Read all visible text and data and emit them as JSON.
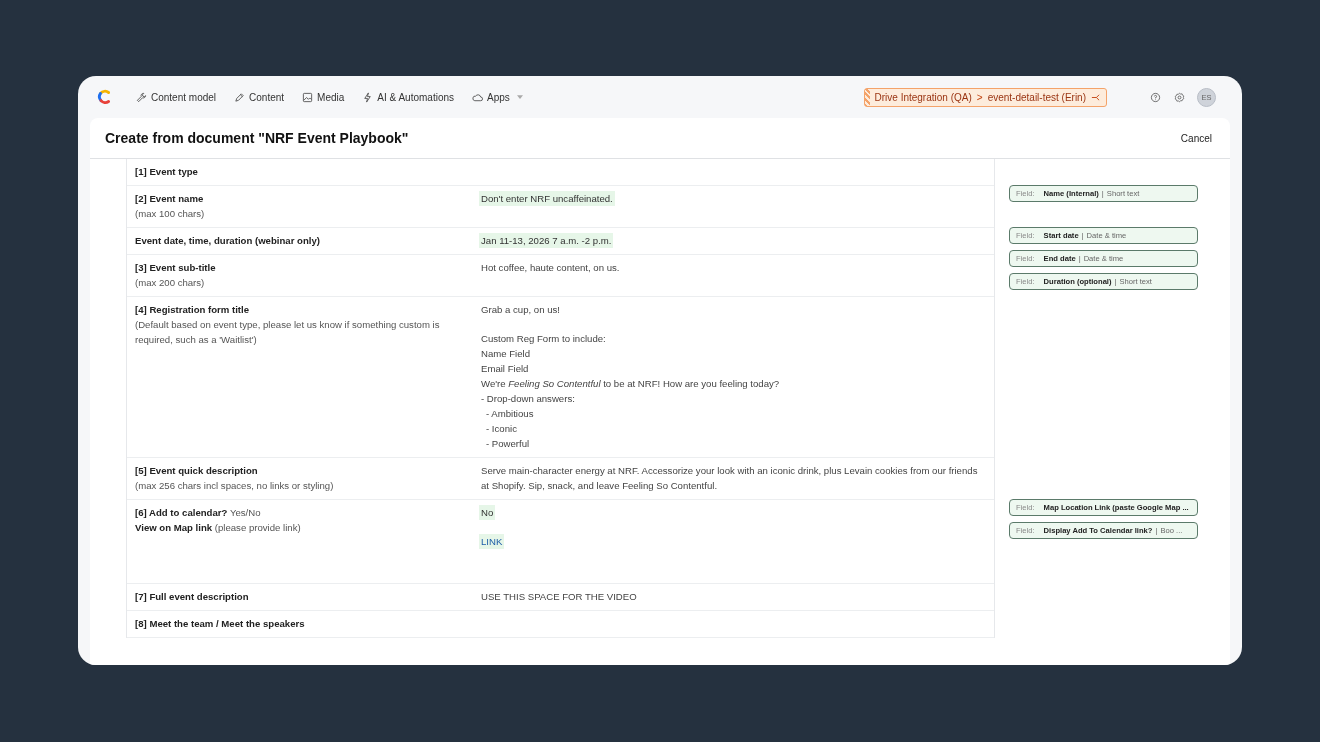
{
  "nav": {
    "items": [
      {
        "kind": "wrench",
        "label": "Content model"
      },
      {
        "kind": "pen",
        "label": "Content"
      },
      {
        "kind": "image",
        "label": "Media"
      },
      {
        "kind": "bolt",
        "label": "AI & Automations"
      },
      {
        "kind": "cloud",
        "label": "Apps",
        "caret": true
      }
    ]
  },
  "environment": {
    "space": "Drive Integration (QA)",
    "separator": ">",
    "environment": "event-detail-test (Erin)"
  },
  "user": {
    "initials": "ES"
  },
  "dialog": {
    "title": "Create from document \"NRF Event Playbook\"",
    "cancel": "Cancel"
  },
  "rows": [
    {
      "label": "[1] Event type"
    },
    {
      "label": "[2] Event name",
      "note": "(max 100 chars)",
      "values": [
        {
          "text": "Don't enter NRF uncaffeinated.",
          "kind": "highlight"
        }
      ],
      "tags": [
        {
          "prefix": "Field:",
          "name": "Name (Internal)",
          "separator": "|",
          "type": "Short text"
        }
      ]
    },
    {
      "label": "Event date, time, duration (webinar only)",
      "values": [
        {
          "text": "Jan 11-13, 2026  7 a.m. -2 p.m.",
          "kind": "highlight"
        }
      ],
      "tags": [
        {
          "prefix": "Field:",
          "name": "Start date",
          "separator": "|",
          "type": "Date & time"
        },
        {
          "prefix": "Field:",
          "name": "End date",
          "separator": "|",
          "type": "Date & time"
        },
        {
          "prefix": "Field:",
          "name": "Duration (optional)",
          "separator": "|",
          "type": "Short text"
        }
      ]
    },
    {
      "label": "[3] Event sub-title",
      "note": "(max 200 chars)",
      "values": [
        {
          "text": "Hot coffee, haute content, on us.",
          "kind": "plain"
        }
      ]
    },
    {
      "label": "[4] Registration form title",
      "note": "(Default based on event type, please let us know if something custom is required, such as a 'Waitlist')",
      "values": [
        {
          "text": "Grab a cup, on us!",
          "kind": "plain"
        },
        {
          "text": "Custom Reg Form to include:",
          "kind": "plain",
          "gap_before": true
        },
        {
          "text": "Name Field",
          "kind": "plain"
        },
        {
          "text": "Email Field",
          "kind": "plain"
        },
        {
          "text": "We're *Feeling So Contentful* to be at NRF! How are you feeling today?",
          "kind": "plain"
        },
        {
          "text": "- Drop-down answers:",
          "kind": "plain"
        },
        {
          "text": "- Ambitious",
          "kind": "indent"
        },
        {
          "text": "- Iconic",
          "kind": "indent"
        },
        {
          "text": "- Powerful",
          "kind": "indent"
        }
      ]
    },
    {
      "label": "[5] Event quick description",
      "note": "(max 256 chars incl spaces, no links or styling)",
      "values": [
        {
          "text": "Serve main-character energy at NRF. Accessorize your look with an iconic drink, plus Levain cookies from our friends at Shopify. Sip, snack, and leave Feeling So Contentful.",
          "kind": "plain"
        }
      ]
    },
    {
      "label_lines": [
        "**[6] Add to calendar?** Yes/No",
        "**View on Map link** (please provide link)"
      ],
      "values": [
        {
          "text": "No",
          "kind": "highlight"
        },
        {
          "text": "LINK",
          "kind": "link",
          "gap_before": true
        }
      ],
      "tags": [
        {
          "prefix": "Field:",
          "name": "Map Location Link (paste Google Map ..."
        },
        {
          "prefix": "Field:",
          "name": "Display Add To Calendar link?",
          "separator": "|",
          "type": "Boo ..."
        }
      ]
    },
    {
      "label": "[7] Full event description",
      "values": [
        {
          "text": "USE THIS SPACE FOR THE VIDEO",
          "kind": "plain"
        }
      ]
    },
    {
      "label": "[8] Meet the team / Meet the speakers"
    }
  ]
}
